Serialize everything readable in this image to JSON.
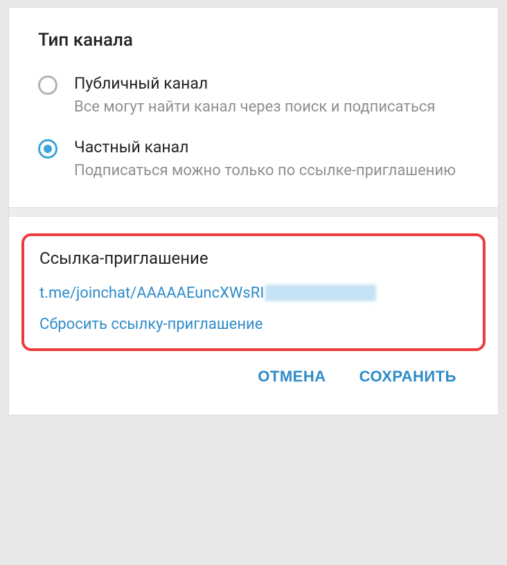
{
  "dialog": {
    "title": "Тип канала",
    "options": [
      {
        "label": "Публичный канал",
        "description": "Все могут найти канал через поиск и подписаться",
        "selected": false
      },
      {
        "label": "Частный канал",
        "description": "Подписаться можно только по ссылке-приглашению",
        "selected": true
      }
    ],
    "invite": {
      "title": "Ссылка-приглашение",
      "link": "t.me/joinchat/AAAAAEuncXWsRI",
      "reset_label": "Сбросить ссылку-приглашение"
    },
    "buttons": {
      "cancel": "ОТМЕНА",
      "save": "СОХРАНИТЬ"
    }
  }
}
